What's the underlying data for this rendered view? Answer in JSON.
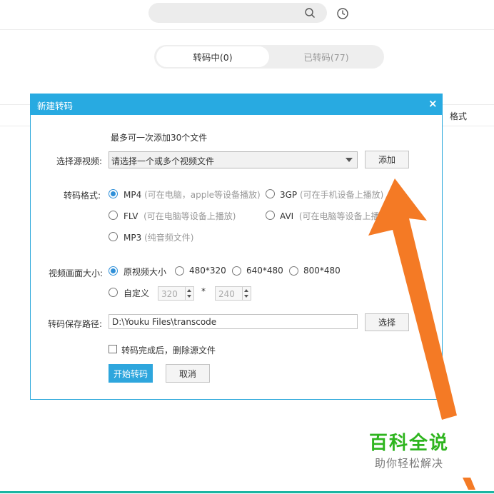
{
  "header": {
    "search_icon": "search-icon",
    "history_icon": "clock-icon"
  },
  "tabs": [
    {
      "label": "转码中(0)",
      "active": true
    },
    {
      "label": "已转码(77)",
      "active": false
    }
  ],
  "background_table": {
    "columns": [
      "格式"
    ]
  },
  "dialog": {
    "title": "新建转码",
    "close_label": "×",
    "max_files_hint": "最多可一次添加30个文件",
    "source_label": "选择源视频:",
    "source_placeholder": "请选择一个或多个视频文件",
    "add_button": "添加",
    "format_label": "转码格式:",
    "formats": [
      {
        "name": "MP4",
        "desc": "(可在电脑，apple等设备播放)",
        "selected": true
      },
      {
        "name": "3GP",
        "desc": "(可在手机设备上播放)",
        "selected": false
      },
      {
        "name": "FLV",
        "desc": "(可在电脑等设备上播放)",
        "selected": false
      },
      {
        "name": "AVI",
        "desc": "(可在电脑等设备上播",
        "selected": false
      },
      {
        "name": "MP3",
        "desc": "(纯音频文件)",
        "selected": false
      }
    ],
    "size_label": "视频画面大小:",
    "sizes": [
      {
        "name": "原视频大小",
        "selected": true
      },
      {
        "name": "480*320",
        "selected": false
      },
      {
        "name": "640*480",
        "selected": false
      },
      {
        "name": "800*480",
        "selected": false
      },
      {
        "name": "自定义",
        "selected": false
      }
    ],
    "custom_width": "320",
    "custom_sep": "*",
    "custom_height": "240",
    "path_label": "转码保存路径:",
    "path_value": "D:\\Youku Files\\transcode",
    "browse_button": "选择",
    "delete_source_label": "转码完成后，删除源文件",
    "delete_source_checked": false,
    "start_button": "开始转码",
    "cancel_button": "取消"
  },
  "watermark": {
    "title": "百科全说",
    "subtitle": "助你轻松解决"
  },
  "colors": {
    "accent": "#28aae1",
    "arrow": "#f47a25",
    "watermark_green": "#2fb51f"
  }
}
